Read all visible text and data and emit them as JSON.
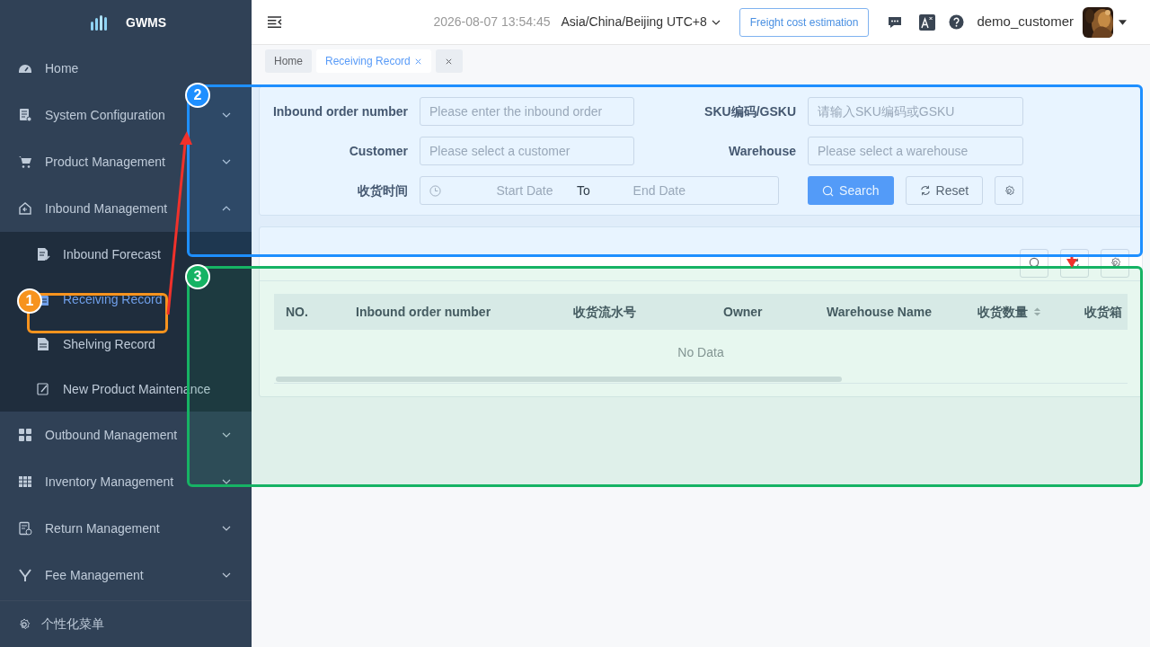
{
  "brand": {
    "name": "GWMS"
  },
  "sidebar": {
    "items": [
      {
        "kind": "link",
        "label": "Home"
      },
      {
        "kind": "group",
        "label": "System Configuration",
        "expanded": false
      },
      {
        "kind": "group",
        "label": "Product Management",
        "expanded": false
      },
      {
        "kind": "group",
        "label": "Inbound Management",
        "expanded": true,
        "children": [
          {
            "label": "Inbound Forecast",
            "selected": false
          },
          {
            "label": "Receiving Record",
            "selected": true
          },
          {
            "label": "Shelving Record",
            "selected": false
          },
          {
            "label": "New Product Maintenance",
            "selected": false
          }
        ]
      },
      {
        "kind": "group",
        "label": "Outbound Management",
        "expanded": false
      },
      {
        "kind": "group",
        "label": "Inventory Management",
        "expanded": false
      },
      {
        "kind": "group",
        "label": "Return Management",
        "expanded": false
      },
      {
        "kind": "group",
        "label": "Fee Management",
        "expanded": false
      }
    ],
    "footer": "个性化菜单"
  },
  "header": {
    "datetime": "2026-08-07 13:54:45",
    "timezone": "Asia/China/Beijing UTC+8",
    "freight_button": "Freight cost estimation",
    "username": "demo_customer"
  },
  "tabs": [
    {
      "label": "Home",
      "selected": false,
      "closable": false
    },
    {
      "label": "Receiving Record",
      "selected": true,
      "closable": true
    }
  ],
  "filters": [
    {
      "label": "Inbound order number",
      "placeholder": "Please enter the inbound order"
    },
    {
      "label": "SKU编码/GSKU",
      "placeholder": "请输入SKU编码或GSKU"
    },
    {
      "label": "Customer",
      "placeholder": "Please select a customer"
    },
    {
      "label": "Warehouse",
      "placeholder": "Please select a warehouse"
    }
  ],
  "date_range": {
    "label": "收货时间",
    "start_placeholder": "Start Date",
    "separator": "To",
    "end_placeholder": "End Date"
  },
  "buttons": {
    "search": "Search",
    "reset": "Reset"
  },
  "table": {
    "columns": [
      {
        "label": "NO.",
        "sortable": false
      },
      {
        "label": "Inbound order number",
        "sortable": false
      },
      {
        "label": "收货流水号",
        "sortable": false
      },
      {
        "label": "Owner",
        "sortable": false
      },
      {
        "label": "Warehouse Name",
        "sortable": false
      },
      {
        "label": "收货数量",
        "sortable": true
      },
      {
        "label": "收货箱",
        "sortable": false
      }
    ],
    "empty_text": "No Data"
  },
  "annotations": [
    {
      "number": "1",
      "color": "#f7931e"
    },
    {
      "number": "2",
      "color": "#1e8fff"
    },
    {
      "number": "3",
      "color": "#16b364"
    }
  ]
}
